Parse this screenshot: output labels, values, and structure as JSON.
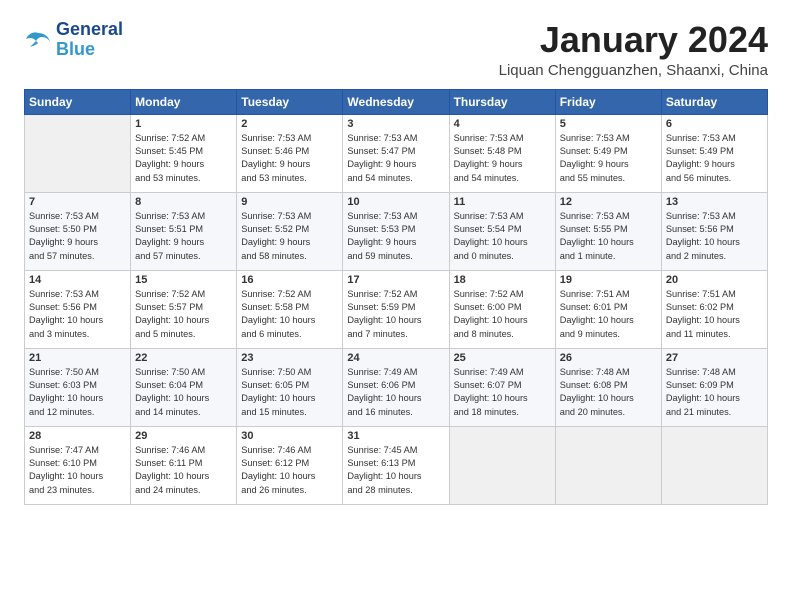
{
  "header": {
    "logo_line1": "General",
    "logo_line2": "Blue",
    "title": "January 2024",
    "subtitle": "Liquan Chengguanzhen, Shaanxi, China"
  },
  "days_of_week": [
    "Sunday",
    "Monday",
    "Tuesday",
    "Wednesday",
    "Thursday",
    "Friday",
    "Saturday"
  ],
  "weeks": [
    [
      {
        "num": "",
        "info": ""
      },
      {
        "num": "1",
        "info": "Sunrise: 7:52 AM\nSunset: 5:45 PM\nDaylight: 9 hours\nand 53 minutes."
      },
      {
        "num": "2",
        "info": "Sunrise: 7:53 AM\nSunset: 5:46 PM\nDaylight: 9 hours\nand 53 minutes."
      },
      {
        "num": "3",
        "info": "Sunrise: 7:53 AM\nSunset: 5:47 PM\nDaylight: 9 hours\nand 54 minutes."
      },
      {
        "num": "4",
        "info": "Sunrise: 7:53 AM\nSunset: 5:48 PM\nDaylight: 9 hours\nand 54 minutes."
      },
      {
        "num": "5",
        "info": "Sunrise: 7:53 AM\nSunset: 5:49 PM\nDaylight: 9 hours\nand 55 minutes."
      },
      {
        "num": "6",
        "info": "Sunrise: 7:53 AM\nSunset: 5:49 PM\nDaylight: 9 hours\nand 56 minutes."
      }
    ],
    [
      {
        "num": "7",
        "info": "Sunrise: 7:53 AM\nSunset: 5:50 PM\nDaylight: 9 hours\nand 57 minutes."
      },
      {
        "num": "8",
        "info": "Sunrise: 7:53 AM\nSunset: 5:51 PM\nDaylight: 9 hours\nand 57 minutes."
      },
      {
        "num": "9",
        "info": "Sunrise: 7:53 AM\nSunset: 5:52 PM\nDaylight: 9 hours\nand 58 minutes."
      },
      {
        "num": "10",
        "info": "Sunrise: 7:53 AM\nSunset: 5:53 PM\nDaylight: 9 hours\nand 59 minutes."
      },
      {
        "num": "11",
        "info": "Sunrise: 7:53 AM\nSunset: 5:54 PM\nDaylight: 10 hours\nand 0 minutes."
      },
      {
        "num": "12",
        "info": "Sunrise: 7:53 AM\nSunset: 5:55 PM\nDaylight: 10 hours\nand 1 minute."
      },
      {
        "num": "13",
        "info": "Sunrise: 7:53 AM\nSunset: 5:56 PM\nDaylight: 10 hours\nand 2 minutes."
      }
    ],
    [
      {
        "num": "14",
        "info": "Sunrise: 7:53 AM\nSunset: 5:56 PM\nDaylight: 10 hours\nand 3 minutes."
      },
      {
        "num": "15",
        "info": "Sunrise: 7:52 AM\nSunset: 5:57 PM\nDaylight: 10 hours\nand 5 minutes."
      },
      {
        "num": "16",
        "info": "Sunrise: 7:52 AM\nSunset: 5:58 PM\nDaylight: 10 hours\nand 6 minutes."
      },
      {
        "num": "17",
        "info": "Sunrise: 7:52 AM\nSunset: 5:59 PM\nDaylight: 10 hours\nand 7 minutes."
      },
      {
        "num": "18",
        "info": "Sunrise: 7:52 AM\nSunset: 6:00 PM\nDaylight: 10 hours\nand 8 minutes."
      },
      {
        "num": "19",
        "info": "Sunrise: 7:51 AM\nSunset: 6:01 PM\nDaylight: 10 hours\nand 9 minutes."
      },
      {
        "num": "20",
        "info": "Sunrise: 7:51 AM\nSunset: 6:02 PM\nDaylight: 10 hours\nand 11 minutes."
      }
    ],
    [
      {
        "num": "21",
        "info": "Sunrise: 7:50 AM\nSunset: 6:03 PM\nDaylight: 10 hours\nand 12 minutes."
      },
      {
        "num": "22",
        "info": "Sunrise: 7:50 AM\nSunset: 6:04 PM\nDaylight: 10 hours\nand 14 minutes."
      },
      {
        "num": "23",
        "info": "Sunrise: 7:50 AM\nSunset: 6:05 PM\nDaylight: 10 hours\nand 15 minutes."
      },
      {
        "num": "24",
        "info": "Sunrise: 7:49 AM\nSunset: 6:06 PM\nDaylight: 10 hours\nand 16 minutes."
      },
      {
        "num": "25",
        "info": "Sunrise: 7:49 AM\nSunset: 6:07 PM\nDaylight: 10 hours\nand 18 minutes."
      },
      {
        "num": "26",
        "info": "Sunrise: 7:48 AM\nSunset: 6:08 PM\nDaylight: 10 hours\nand 20 minutes."
      },
      {
        "num": "27",
        "info": "Sunrise: 7:48 AM\nSunset: 6:09 PM\nDaylight: 10 hours\nand 21 minutes."
      }
    ],
    [
      {
        "num": "28",
        "info": "Sunrise: 7:47 AM\nSunset: 6:10 PM\nDaylight: 10 hours\nand 23 minutes."
      },
      {
        "num": "29",
        "info": "Sunrise: 7:46 AM\nSunset: 6:11 PM\nDaylight: 10 hours\nand 24 minutes."
      },
      {
        "num": "30",
        "info": "Sunrise: 7:46 AM\nSunset: 6:12 PM\nDaylight: 10 hours\nand 26 minutes."
      },
      {
        "num": "31",
        "info": "Sunrise: 7:45 AM\nSunset: 6:13 PM\nDaylight: 10 hours\nand 28 minutes."
      },
      {
        "num": "",
        "info": ""
      },
      {
        "num": "",
        "info": ""
      },
      {
        "num": "",
        "info": ""
      }
    ]
  ]
}
